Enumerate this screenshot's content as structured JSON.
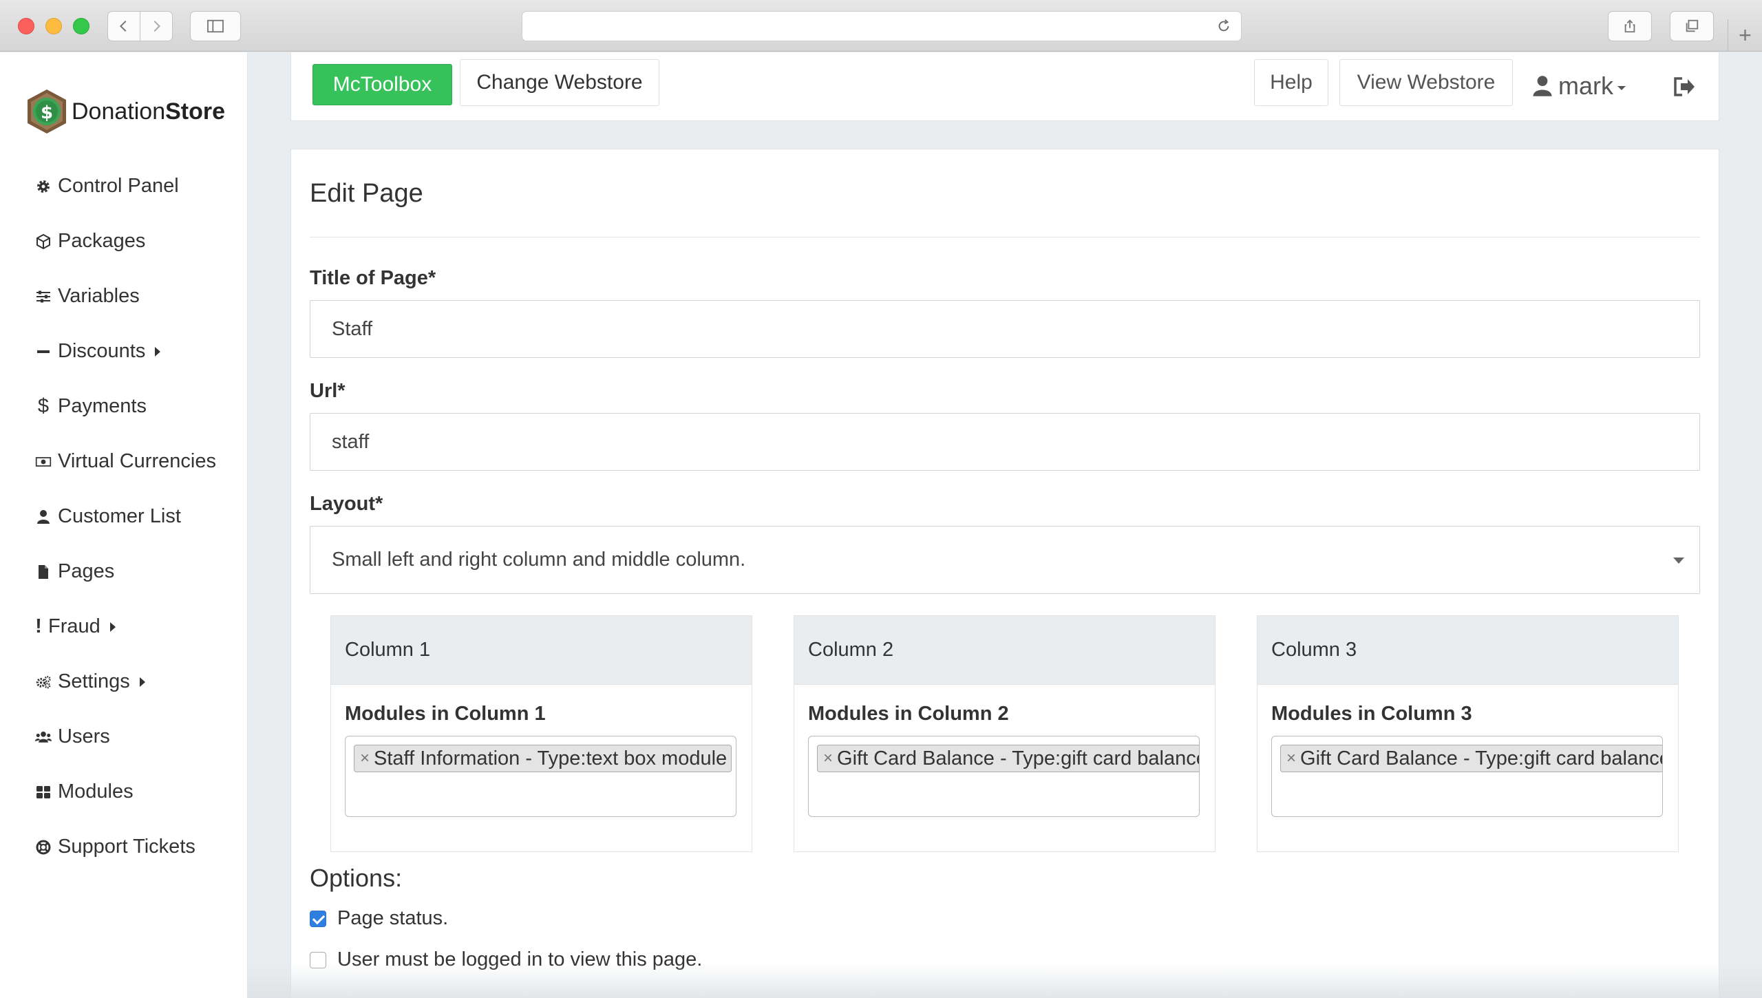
{
  "browser": {
    "url": ""
  },
  "brand": {
    "name_regular": "Donation",
    "name_bold": "Store"
  },
  "sidebar": {
    "items": [
      {
        "label": "Control Panel",
        "icon": "gear-icon"
      },
      {
        "label": "Packages",
        "icon": "cube-icon"
      },
      {
        "label": "Variables",
        "icon": "sliders-icon"
      },
      {
        "label": "Discounts",
        "icon": "minus-icon",
        "has_submenu": true
      },
      {
        "label": "Payments",
        "icon": "dollar-icon"
      },
      {
        "label": "Virtual Currencies",
        "icon": "money-icon"
      },
      {
        "label": "Customer List",
        "icon": "user-icon"
      },
      {
        "label": "Pages",
        "icon": "file-icon"
      },
      {
        "label": "Fraud",
        "icon": "exclamation-icon",
        "has_submenu": true
      },
      {
        "label": "Settings",
        "icon": "gears-icon",
        "has_submenu": true
      },
      {
        "label": "Users",
        "icon": "users-icon"
      },
      {
        "label": "Modules",
        "icon": "grid-icon"
      },
      {
        "label": "Support Tickets",
        "icon": "lifering-icon"
      }
    ]
  },
  "header": {
    "store_button": "McToolbox",
    "change_button": "Change Webstore",
    "help_button": "Help",
    "view_button": "View Webstore",
    "username": "mark"
  },
  "form": {
    "title": "Edit Page",
    "title_label": "Title of Page*",
    "title_value": "Staff",
    "url_label": "Url*",
    "url_value": "staff",
    "layout_label": "Layout*",
    "layout_value": "Small left and right column and middle column.",
    "columns": [
      {
        "heading": "Column 1",
        "modules_label": "Modules in Column 1",
        "tag": "Staff Information - Type:text box module"
      },
      {
        "heading": "Column 2",
        "modules_label": "Modules in Column 2",
        "tag": "Gift Card Balance - Type:gift card balance"
      },
      {
        "heading": "Column 3",
        "modules_label": "Modules in Column 3",
        "tag": "Gift Card Balance - Type:gift card balance"
      }
    ],
    "options_title": "Options:",
    "options": [
      {
        "label": "Page status.",
        "checked": true
      },
      {
        "label": "User must be logged in to view this page.",
        "checked": false
      }
    ]
  },
  "colors": {
    "accent_green": "#36c15a",
    "checkbox_blue": "#2f7fe0",
    "background": "#e9edf0"
  }
}
